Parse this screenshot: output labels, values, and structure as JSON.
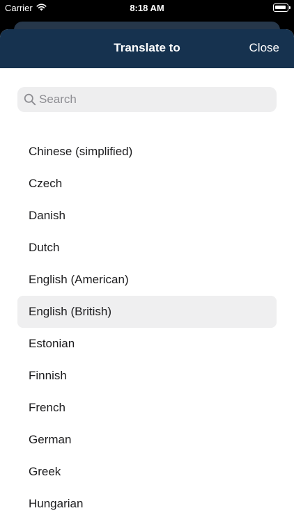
{
  "status_bar": {
    "carrier": "Carrier",
    "time": "8:18 AM"
  },
  "header": {
    "title": "Translate to",
    "close_label": "Close"
  },
  "search": {
    "placeholder": "Search",
    "value": ""
  },
  "languages": [
    {
      "label": "Chinese (simplified)",
      "selected": false
    },
    {
      "label": "Czech",
      "selected": false
    },
    {
      "label": "Danish",
      "selected": false
    },
    {
      "label": "Dutch",
      "selected": false
    },
    {
      "label": "English (American)",
      "selected": false
    },
    {
      "label": "English (British)",
      "selected": true
    },
    {
      "label": "Estonian",
      "selected": false
    },
    {
      "label": "Finnish",
      "selected": false
    },
    {
      "label": "French",
      "selected": false
    },
    {
      "label": "German",
      "selected": false
    },
    {
      "label": "Greek",
      "selected": false
    },
    {
      "label": "Hungarian",
      "selected": false
    }
  ],
  "colors": {
    "header_bg": "#16324f",
    "selected_row_bg": "#efeff0",
    "search_bg": "#eeeeef"
  }
}
